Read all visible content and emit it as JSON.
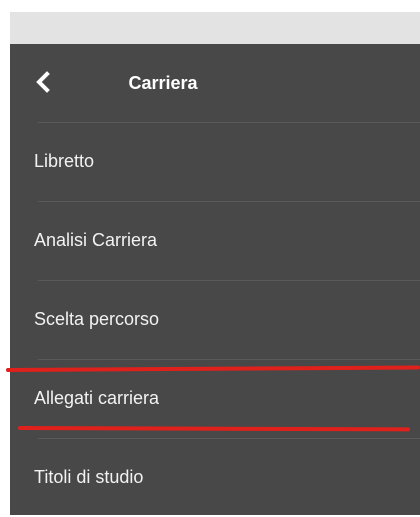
{
  "header": {
    "title": "Carriera",
    "back_icon": "chevron-left-icon"
  },
  "menu": {
    "items": [
      {
        "label": "Libretto"
      },
      {
        "label": "Analisi Carriera"
      },
      {
        "label": "Scelta percorso"
      },
      {
        "label": "Allegati carriera"
      },
      {
        "label": "Titoli di studio"
      }
    ]
  },
  "colors": {
    "panel_background": "#484848",
    "top_strip": "#e3e3e3",
    "text": "#f2f2f2",
    "highlight_annotation": "#e0201b"
  }
}
